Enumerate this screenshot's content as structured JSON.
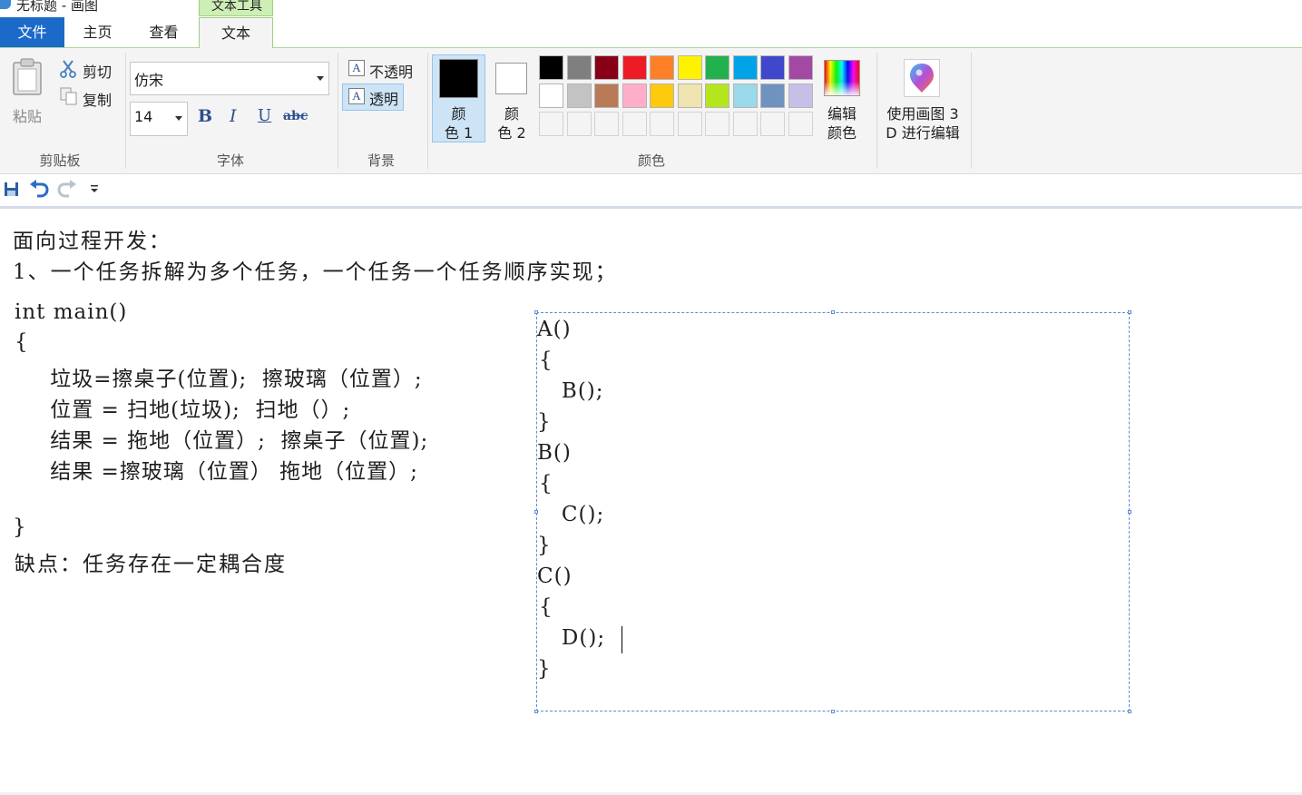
{
  "window": {
    "title": "无标题 - 画图"
  },
  "tabs": {
    "context_group": "文本工具",
    "file": "文件",
    "home": "主页",
    "view": "查看",
    "text": "文本"
  },
  "clipboard": {
    "paste": "粘贴",
    "cut": "剪切",
    "copy": "复制",
    "label": "剪贴板"
  },
  "font": {
    "family": "仿宋",
    "size": "14",
    "bold": "B",
    "italic": "I",
    "underline": "U",
    "strike": "abc",
    "label": "字体"
  },
  "background": {
    "opaque": "不透明",
    "transparent": "透明",
    "label": "背景",
    "selected": "透明"
  },
  "colors": {
    "color1_line1": "颜",
    "color1_line2": "色 1",
    "color2_line1": "颜",
    "color2_line2": "色 2",
    "edit_line1": "编辑",
    "edit_line2": "颜色",
    "label": "颜色",
    "color1": "#000000",
    "color2": "#ffffff",
    "palette_row1": [
      "#000000",
      "#7f7f7f",
      "#880015",
      "#ed1c24",
      "#ff7f27",
      "#fff200",
      "#22b14c",
      "#00a2e8",
      "#3f48cc",
      "#a349a4"
    ],
    "palette_row2": [
      "#ffffff",
      "#c3c3c3",
      "#b97a57",
      "#ffaec9",
      "#ffc90e",
      "#efe4b0",
      "#b5e61d",
      "#99d9ea",
      "#7092be",
      "#c8bfe7"
    ]
  },
  "paint3d": {
    "line1": "使用画图 3",
    "line2": "D 进行编辑"
  },
  "canvas": {
    "line1": "面向过程开发：",
    "line2": "1、一个任务拆解为多个任务，一个任务一个任务顺序实现；",
    "code": {
      "l1": "int main()",
      "l2": "{",
      "l3": "    垃圾=擦桌子(位置);  擦玻璃（位置）;",
      "l4": "    位置 = 扫地(垃圾);  扫地（）;",
      "l5": "    结果 = 拖地（位置）;  擦桌子（位置);",
      "l6": "    结果 =擦玻璃（位置） 拖地（位置）;",
      "l7": "}",
      "l8": "缺点：任务存在一定耦合度"
    },
    "box": {
      "b1": "A()",
      "b2": "{",
      "b3": "   B();",
      "b4": "}",
      "b5": "B()",
      "b6": "{",
      "b7": "   C();",
      "b8": "}",
      "b9": "C()",
      "b10": "{",
      "b11": "   D();",
      "b12": "}"
    }
  }
}
